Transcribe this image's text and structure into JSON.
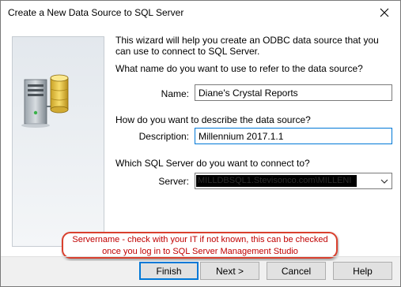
{
  "window": {
    "title": "Create a New Data Source to SQL Server"
  },
  "intro": "This wizard will help you create an ODBC data source that you can use to connect to SQL Server.",
  "name_section": {
    "question": "What name do you want to use to refer to the data source?",
    "label": "Name:",
    "value": "Diane's Crystal Reports"
  },
  "description_section": {
    "question": "How do you want to describe the data source?",
    "label": "Description:",
    "value": "Millennium 2017.1.1"
  },
  "server_section": {
    "question": "Which SQL Server do you want to connect to?",
    "label": "Server:",
    "value": "MILLDBSQL1.Stevisonco.com\\MILLENI"
  },
  "callout": {
    "text": "Servername - check with your IT if not known, this can be checked once you log in to SQL Server Management Studio"
  },
  "buttons": {
    "finish": "Finish",
    "next": "Next >",
    "cancel": "Cancel",
    "help": "Help"
  },
  "colors": {
    "callout_border": "#d9412e",
    "callout_text": "#c00000",
    "focus_border": "#0078d7"
  },
  "icons": {
    "close": "close-icon",
    "combo": "chevron-down-icon",
    "art": "server-database-icon"
  }
}
